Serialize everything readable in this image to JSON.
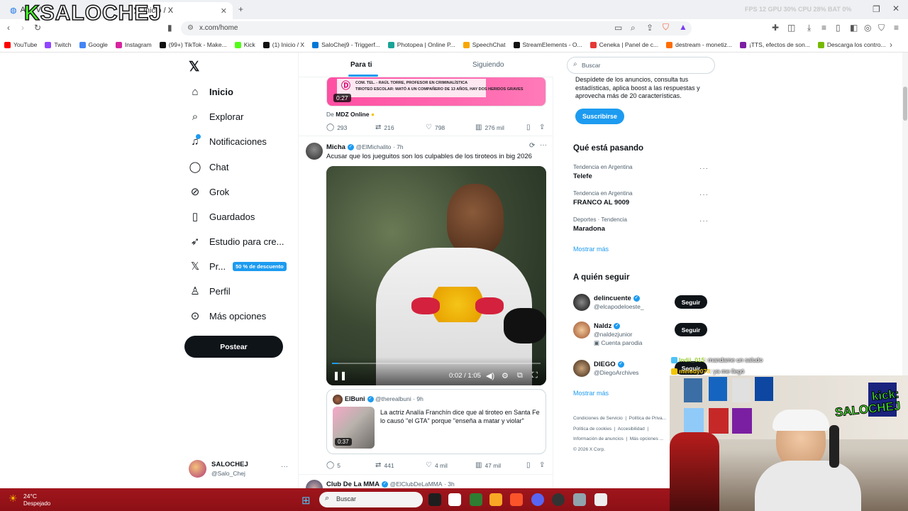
{
  "browser": {
    "tabs": [
      {
        "label": "Al... Ve..."
      },
      {
        "label": "Inicio / X"
      }
    ],
    "url": "x.com/home",
    "stats_overlay": "FPS 12   GPU 30%   CPU 28%   BAT 0%",
    "bookmarks": [
      {
        "label": "YouTube",
        "color": "#ff0000"
      },
      {
        "label": "Twitch",
        "color": "#9146ff"
      },
      {
        "label": "Google",
        "color": "#4285f4"
      },
      {
        "label": "Instagram",
        "color": "#d6249f"
      },
      {
        "label": "(99+) TikTok - Make...",
        "color": "#111111"
      },
      {
        "label": "Kick",
        "color": "#53fc18"
      },
      {
        "label": "(1) Inicio / X",
        "color": "#111111"
      },
      {
        "label": "SaloChej9 - Triggerf...",
        "color": "#0078d7"
      },
      {
        "label": "Photopea | Online P...",
        "color": "#18a497"
      },
      {
        "label": "SpeechChat",
        "color": "#f7a700"
      },
      {
        "label": "StreamElements - O...",
        "color": "#111111"
      },
      {
        "label": "Ceneka | Panel de c...",
        "color": "#e53935"
      },
      {
        "label": "destream - monetiz...",
        "color": "#ff6d00"
      },
      {
        "label": "¡TTS, efectos de son...",
        "color": "#7b1fa2"
      },
      {
        "label": "Descarga los contro...",
        "color": "#76b900"
      }
    ]
  },
  "streamer_logo": "SALOCHEJ",
  "nav": {
    "items": [
      {
        "label": "Inicio",
        "icon": "home-icon"
      },
      {
        "label": "Explorar",
        "icon": "search-icon"
      },
      {
        "label": "Notificaciones",
        "icon": "bell-icon"
      },
      {
        "label": "Chat",
        "icon": "chat-icon"
      },
      {
        "label": "Grok",
        "icon": "grok-icon"
      },
      {
        "label": "Guardados",
        "icon": "bookmark-icon"
      },
      {
        "label": "Estudio para cre...",
        "icon": "rocket-icon"
      },
      {
        "label": "Pr...",
        "icon": "x-logo-icon"
      },
      {
        "label": "Perfil",
        "icon": "person-icon"
      },
      {
        "label": "Más opciones",
        "icon": "more-icon"
      }
    ],
    "premium_badge": "50 % de descuento",
    "post_button": "Postear",
    "account": {
      "name": "SALOCHEJ",
      "handle": "@Salo_Chej"
    }
  },
  "feed": {
    "tabs": [
      {
        "label": "Para ti"
      },
      {
        "label": "Siguiendo"
      }
    ],
    "prev_tweet": {
      "video_duration": "0:27",
      "banner_line1": "COM. TEL. - RAÚL TORRE, PROFESOR EN CRIMINALÍSTICA",
      "banner_line2": "TIROTEO ESCOLAR: MATÓ A UN COMPAÑERO DE 13 AÑOS, HAY DOS HERIDOS GRAVES",
      "source_prefix": "De",
      "source": "MDZ Online",
      "replies": "293",
      "retweets": "216",
      "likes": "798",
      "views": "276 mil"
    },
    "tweet": {
      "name": "Micha",
      "handle": "@ElMichalito",
      "time": "· 7h",
      "text": "Acusar que los jueguitos son los culpables de los tiroteos in big 2026",
      "video_time": "0:02 / 1:05",
      "progress": 0.03,
      "quote": {
        "name": "ElBuni",
        "handle": "@therealbuni",
        "time": "· 9h",
        "text": "La actriz Analía Franchín dice que al tiroteo en Santa Fe lo causó \"el GTA\" porque \"enseña a matar y violar\"",
        "duration": "0:37"
      },
      "replies": "5",
      "retweets": "441",
      "likes": "4 mil",
      "views": "47 mil"
    },
    "next_tweet": {
      "name": "Club De La MMA",
      "handle": "@ElClubDeLaMMA",
      "time": "· 3h"
    }
  },
  "sidebar": {
    "search_placeholder": "Buscar",
    "premium_text": "Despídete de los anuncios, consulta tus estadísticas, aplica boost a las respuestas y aprovecha más de 20 características.",
    "subscribe": "Suscribirse",
    "trends_title": "Qué está pasando",
    "trends": [
      {
        "category": "Tendencia en Argentina",
        "name": "Telefe"
      },
      {
        "category": "Tendencia en Argentina",
        "name": "FRANCO AL 9009"
      },
      {
        "category": "Deportes · Tendencia",
        "name": "Maradona"
      }
    ],
    "show_more": "Mostrar más",
    "follow_title": "A quién seguir",
    "follow": [
      {
        "name": "delincuente",
        "handle": "@elcapodeloeste_",
        "extra": "",
        "button": "Seguir"
      },
      {
        "name": "Naldz",
        "handle": "@naldezjunior",
        "extra": "Cuenta parodia",
        "button": "Seguir"
      },
      {
        "name": "DIEGO",
        "handle": "@DiegoArchives",
        "extra": "",
        "button": "Seguir"
      }
    ],
    "show_more2": "Mostrar más",
    "footer": [
      "Condiciones de Servicio",
      "Política de Priva...",
      "Política de cookies",
      "Accesibilidad",
      "Información de anuncios",
      "Más opciones ...",
      "© 2026 X Corp."
    ]
  },
  "stream_chat": [
    {
      "user": "lndii_015",
      "msg": ": mandame un saludo"
    },
    {
      "user": "melody078",
      "msg": ": ya me llegó"
    }
  ],
  "webcam_logo": [
    "kick:",
    "SALOCHEJ"
  ],
  "taskbar": {
    "weather_temp": "24°C",
    "weather_desc": "Despejado",
    "search": "Buscar"
  }
}
